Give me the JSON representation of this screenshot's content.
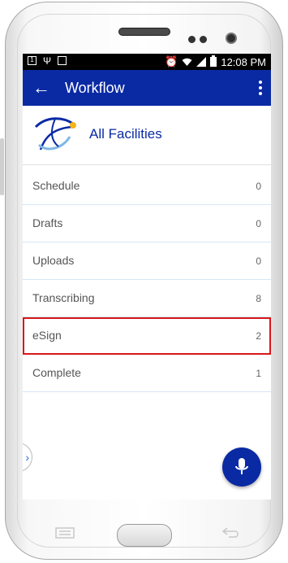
{
  "status_bar": {
    "time": "12:08 PM",
    "left_icons": [
      "notification-1-icon",
      "usb-icon",
      "image-icon"
    ],
    "right_icons": [
      "alarm-icon",
      "wifi-icon",
      "signal-icon",
      "battery-charging-icon"
    ]
  },
  "app_bar": {
    "title": "Workflow",
    "back_icon": "arrow-back-icon",
    "menu_icon": "overflow-menu-icon",
    "background_color": "#0a2aa4"
  },
  "facility": {
    "name": "All Facilities",
    "name_color": "#0a2aa4"
  },
  "workflow_items": [
    {
      "label": "Schedule",
      "count": "0",
      "highlighted": false
    },
    {
      "label": "Drafts",
      "count": "0",
      "highlighted": false
    },
    {
      "label": "Uploads",
      "count": "0",
      "highlighted": false
    },
    {
      "label": "Transcribing",
      "count": "8",
      "highlighted": false
    },
    {
      "label": "eSign",
      "count": "2",
      "highlighted": true
    },
    {
      "label": "Complete",
      "count": "1",
      "highlighted": false
    }
  ],
  "colors": {
    "accent": "#0a2aa4",
    "highlight_border": "#d9171b",
    "divider": "#d7e6f4"
  }
}
